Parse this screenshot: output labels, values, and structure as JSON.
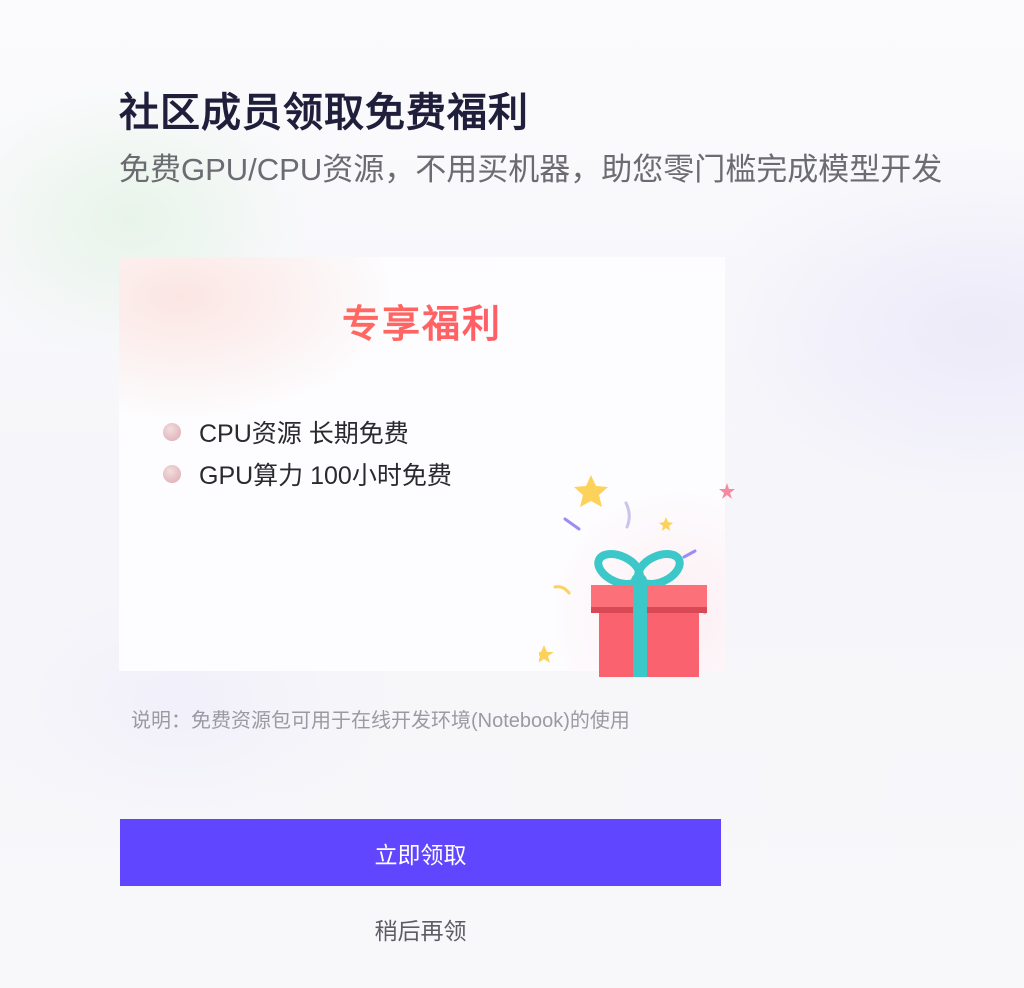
{
  "header": {
    "title": "社区成员领取免费福利",
    "subtitle": "免费GPU/CPU资源，不用买机器，助您零门槛完成模型开发"
  },
  "card": {
    "title": "专享福利",
    "benefits": [
      {
        "label": "CPU资源 长期免费"
      },
      {
        "label": "GPU算力 100小时免费"
      }
    ],
    "illustration": "gift-box-with-stars",
    "accent_colors": {
      "title": "#ff4d6d",
      "gift_box": "#f9626e",
      "ribbon": "#3cc8c8",
      "stars": "#fcd25b"
    }
  },
  "note": "说明：免费资源包可用于在线开发环境(Notebook)的使用",
  "actions": {
    "claim_label": "立即领取",
    "later_label": "稍后再领"
  },
  "colors": {
    "primary_button": "#6146ff",
    "title_text": "#1f1f3c"
  }
}
